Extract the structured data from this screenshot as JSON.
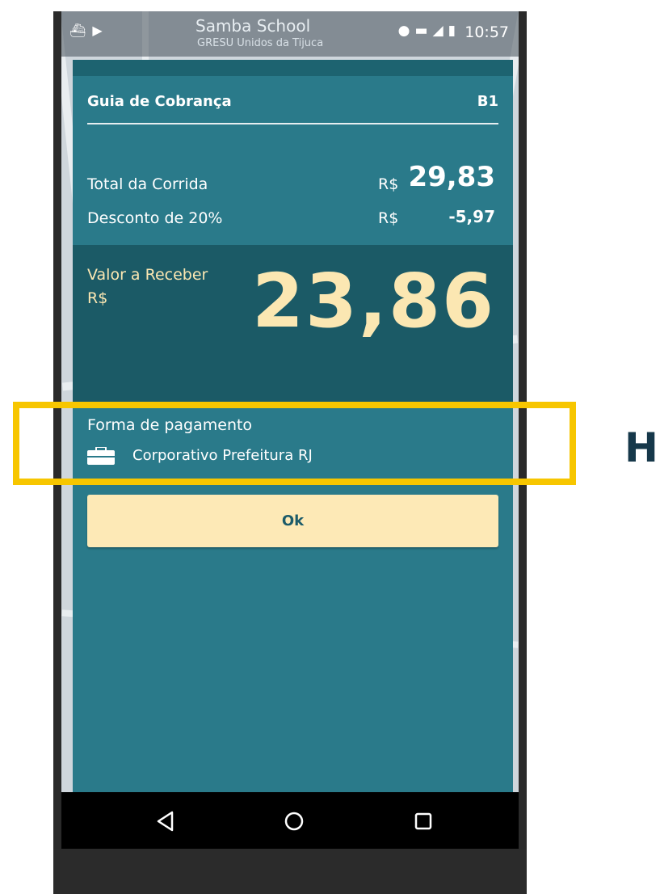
{
  "statusbar": {
    "map_title": "Samba School",
    "map_subtitle": "GRESU Unidos da Tijuca",
    "time": "10:57"
  },
  "dialog": {
    "title": "Guia de Cobrança",
    "code": "B1",
    "total_label": "Total da Corrida",
    "total_currency": "R$",
    "total_value": "29,83",
    "discount_label": "Desconto de 20%",
    "discount_currency": "R$",
    "discount_value": "-5,97",
    "receive_label": "Valor a Receber",
    "receive_currency": "R$",
    "receive_value": "23,86",
    "payment_label": "Forma de pagamento",
    "payment_method": "Corporativo Prefeitura RJ",
    "payment_icon": "briefcase-icon",
    "ok_label": "Ok"
  },
  "navbar": {
    "back_icon": "back-triangle-icon",
    "home_icon": "home-circle-icon",
    "recents_icon": "recents-square-icon"
  },
  "annotation": {
    "side_letter": "H",
    "highlight_color": "#f7c600"
  },
  "colors": {
    "dialog_bg": "#2a7a8a",
    "receive_bg": "#1b5a66",
    "accent_text": "#fbe7b2",
    "button_bg": "#fde9b6"
  }
}
